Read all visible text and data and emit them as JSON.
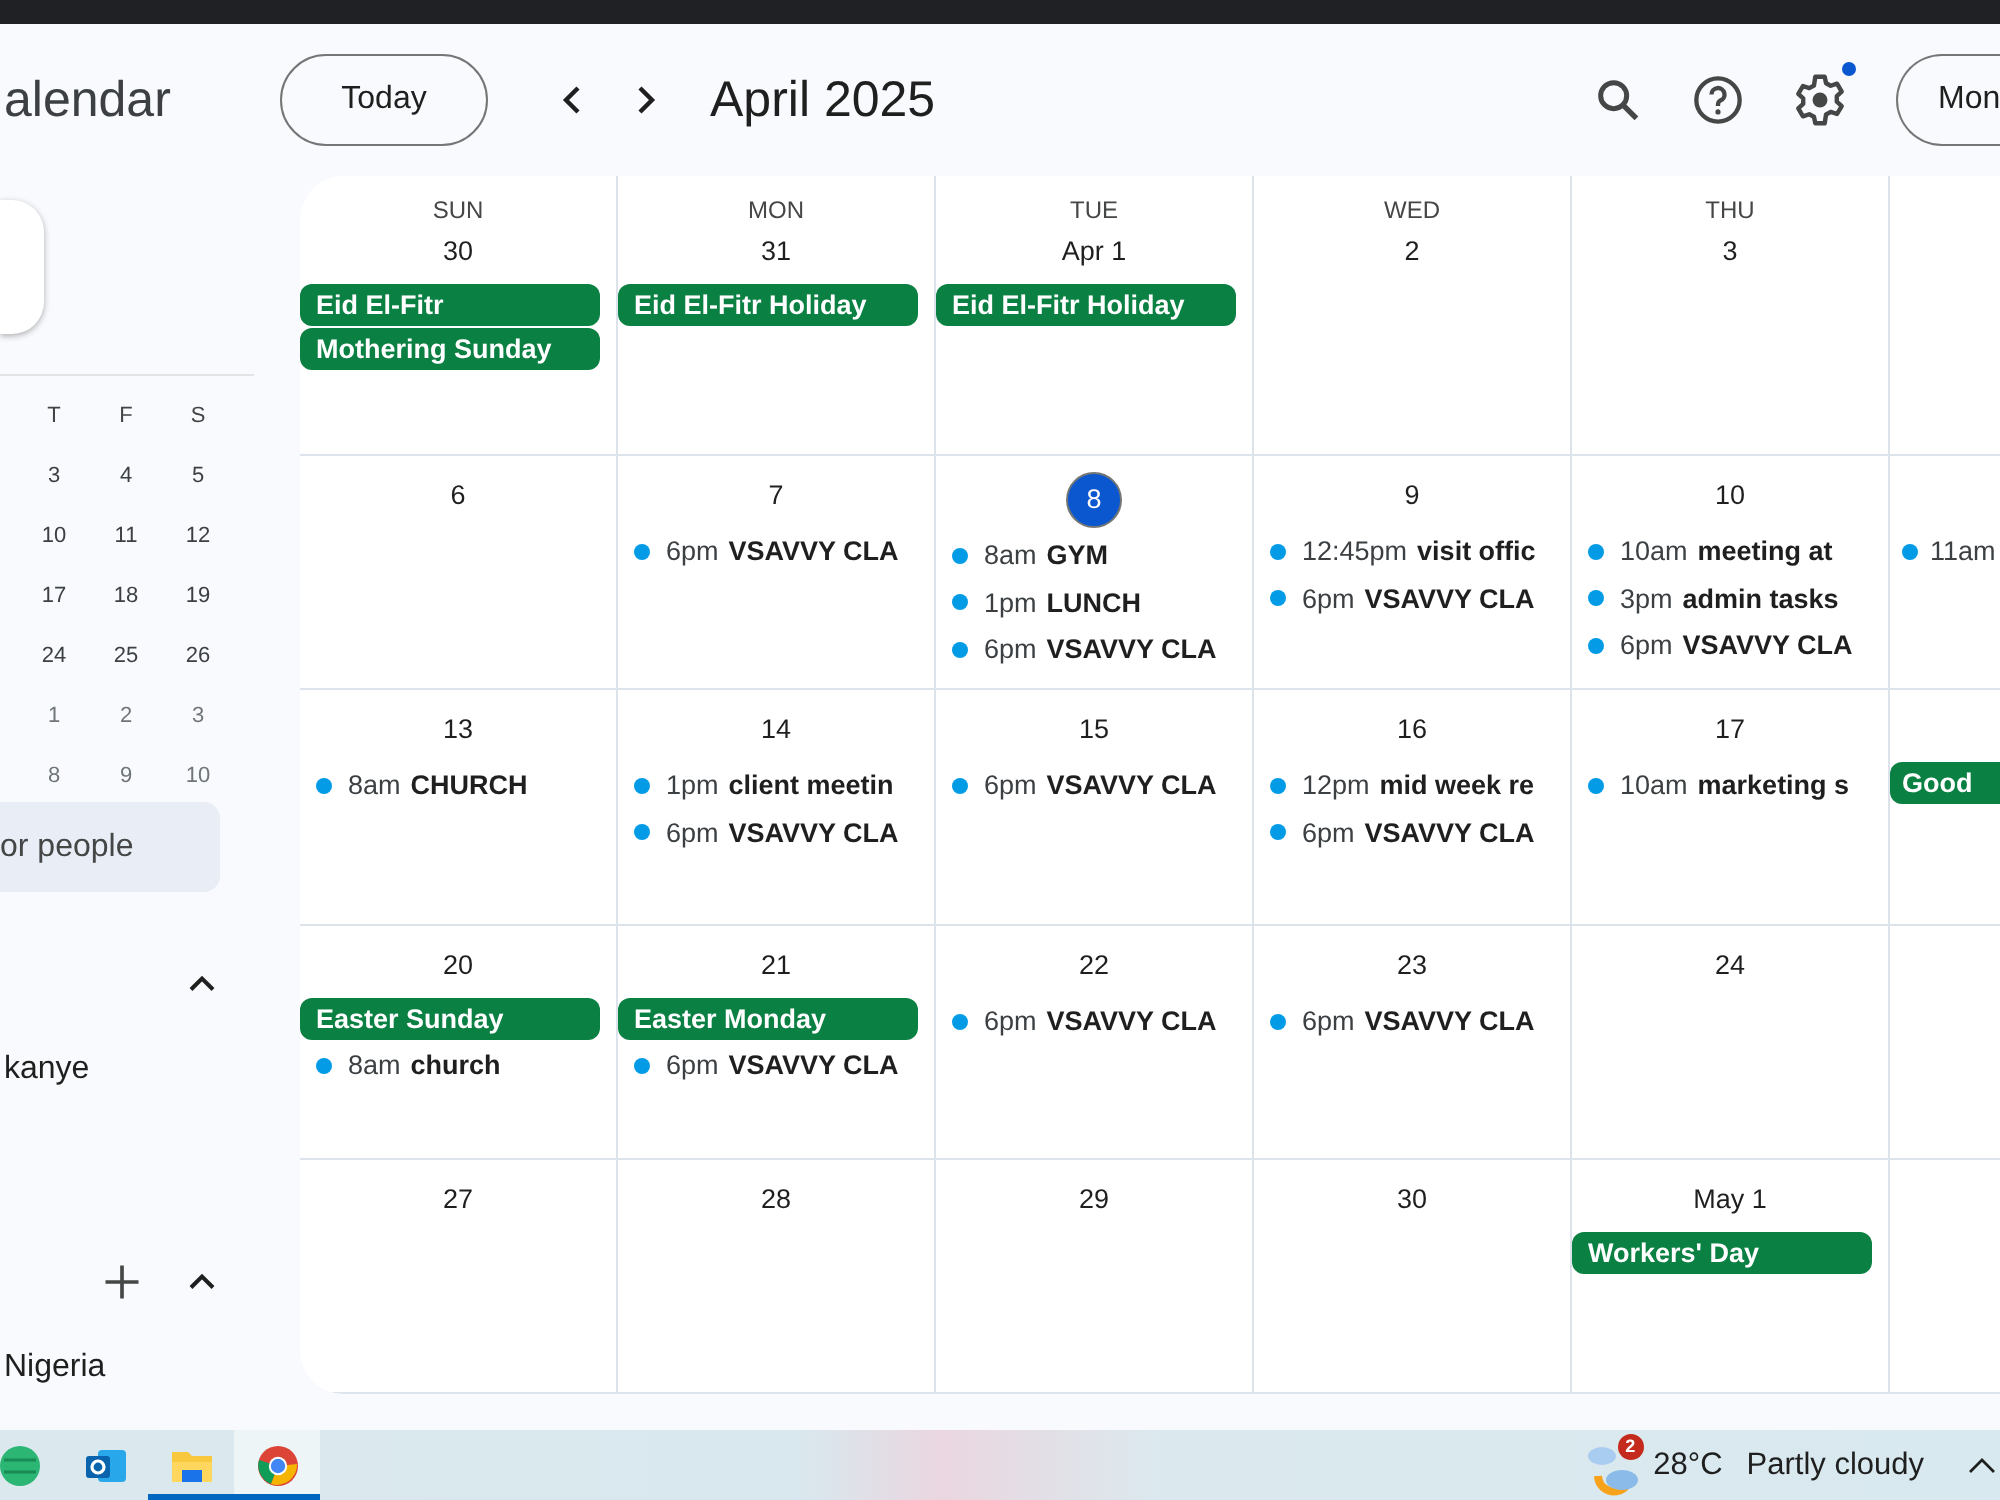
{
  "app_title": "alendar",
  "toolbar": {
    "today_button": "Today",
    "month_title": "April 2025",
    "settings_notification": true,
    "view_button": "Mon"
  },
  "mini_calendar": {
    "weekdays": [
      "T",
      "F",
      "S"
    ],
    "rows": [
      {
        "days": [
          "3",
          "4",
          "5"
        ],
        "dim": false
      },
      {
        "days": [
          "10",
          "11",
          "12"
        ],
        "dim": false
      },
      {
        "days": [
          "17",
          "18",
          "19"
        ],
        "dim": false
      },
      {
        "days": [
          "24",
          "25",
          "26"
        ],
        "dim": false
      },
      {
        "days": [
          "1",
          "2",
          "3"
        ],
        "dim": true
      },
      {
        "days": [
          "8",
          "9",
          "10"
        ],
        "dim": true
      }
    ]
  },
  "people_search": {
    "placeholder": "or people"
  },
  "sidebar_sections": [
    {
      "expanded": true,
      "addable": false,
      "items": [
        "kanye"
      ]
    },
    {
      "expanded": true,
      "addable": true,
      "items": [
        "Nigeria"
      ]
    }
  ],
  "week_headers": [
    "SUN",
    "MON",
    "TUE",
    "WED",
    "THU"
  ],
  "weeks": [
    {
      "days": [
        {
          "date": "30",
          "today": false,
          "events": [
            {
              "kind": "allday",
              "title": "Eid El-Fitr"
            },
            {
              "kind": "allday",
              "title": "Mothering Sunday"
            }
          ]
        },
        {
          "date": "31",
          "today": false,
          "events": [
            {
              "kind": "allday",
              "title": "Eid El-Fitr Holiday"
            }
          ]
        },
        {
          "date": "Apr 1",
          "today": false,
          "events": [
            {
              "kind": "allday",
              "title": "Eid El-Fitr Holiday"
            }
          ]
        },
        {
          "date": "2",
          "today": false
        },
        {
          "date": "3",
          "today": false
        }
      ]
    },
    {
      "days": [
        {
          "date": "6",
          "today": false
        },
        {
          "date": "7",
          "today": false,
          "events": [
            {
              "kind": "timed",
              "time": "6pm",
              "title": "VSAVVY CLA"
            }
          ]
        },
        {
          "date": "8",
          "today": true,
          "events": [
            {
              "kind": "timed",
              "time": "8am",
              "title": "GYM"
            },
            {
              "kind": "timed",
              "time": "1pm",
              "title": "LUNCH"
            },
            {
              "kind": "timed",
              "time": "6pm",
              "title": "VSAVVY CLA"
            }
          ]
        },
        {
          "date": "9",
          "today": false,
          "events": [
            {
              "kind": "timed",
              "time": "12:45pm",
              "title": "visit offic"
            },
            {
              "kind": "timed",
              "time": "6pm",
              "title": "VSAVVY CLA"
            }
          ]
        },
        {
          "date": "10",
          "today": false,
          "events": [
            {
              "kind": "timed",
              "time": "10am",
              "title": "meeting at"
            },
            {
              "kind": "timed",
              "time": "3pm",
              "title": "admin tasks"
            },
            {
              "kind": "timed",
              "time": "6pm",
              "title": "VSAVVY CLA"
            }
          ]
        },
        {
          "events": [
            {
              "kind": "timed",
              "time": "11am"
            }
          ]
        }
      ]
    },
    {
      "days": [
        {
          "date": "13",
          "today": false,
          "events": [
            {
              "kind": "timed",
              "time": "8am",
              "title": "CHURCH"
            }
          ]
        },
        {
          "date": "14",
          "today": false,
          "events": [
            {
              "kind": "timed",
              "time": "1pm",
              "title": "client meetin"
            },
            {
              "kind": "timed",
              "time": "6pm",
              "title": "VSAVVY CLA"
            }
          ]
        },
        {
          "date": "15",
          "today": false,
          "events": [
            {
              "kind": "timed",
              "time": "6pm",
              "title": "VSAVVY CLA"
            }
          ]
        },
        {
          "date": "16",
          "today": false,
          "events": [
            {
              "kind": "timed",
              "time": "12pm",
              "title": "mid week re"
            },
            {
              "kind": "timed",
              "time": "6pm",
              "title": "VSAVVY CLA"
            }
          ]
        },
        {
          "date": "17",
          "today": false,
          "events": [
            {
              "kind": "timed",
              "time": "10am",
              "title": "marketing s"
            }
          ]
        },
        {
          "events": [
            {
              "kind": "allday",
              "title": "Good"
            }
          ]
        }
      ]
    },
    {
      "days": [
        {
          "date": "20",
          "today": false,
          "events": [
            {
              "kind": "allday",
              "title": "Easter Sunday"
            },
            {
              "kind": "timed",
              "time": "8am",
              "title": "church"
            }
          ]
        },
        {
          "date": "21",
          "today": false,
          "events": [
            {
              "kind": "allday",
              "title": "Easter Monday"
            },
            {
              "kind": "timed",
              "time": "6pm",
              "title": "VSAVVY CLA"
            }
          ]
        },
        {
          "date": "22",
          "today": false,
          "events": [
            {
              "kind": "timed",
              "time": "6pm",
              "title": "VSAVVY CLA"
            }
          ]
        },
        {
          "date": "23",
          "today": false,
          "events": [
            {
              "kind": "timed",
              "time": "6pm",
              "title": "VSAVVY CLA"
            }
          ]
        },
        {
          "date": "24",
          "today": false
        }
      ]
    },
    {
      "days": [
        {
          "date": "27",
          "today": false
        },
        {
          "date": "28",
          "today": false
        },
        {
          "date": "29",
          "today": false
        },
        {
          "date": "30",
          "today": false
        },
        {
          "date": "May 1",
          "today": false,
          "events": [
            {
              "kind": "allday",
              "title": "Workers' Day"
            }
          ]
        }
      ]
    }
  ],
  "taskbar": {
    "apps": [
      {
        "kind": "globe",
        "running": false,
        "selected": false
      },
      {
        "kind": "mail",
        "running": false,
        "selected": false
      },
      {
        "kind": "folder",
        "running": true,
        "selected": false
      },
      {
        "kind": "browser",
        "running": true,
        "selected": true
      }
    ],
    "weather": {
      "badge": "2",
      "temperature": "28°C",
      "condition": "Partly cloudy"
    }
  }
}
